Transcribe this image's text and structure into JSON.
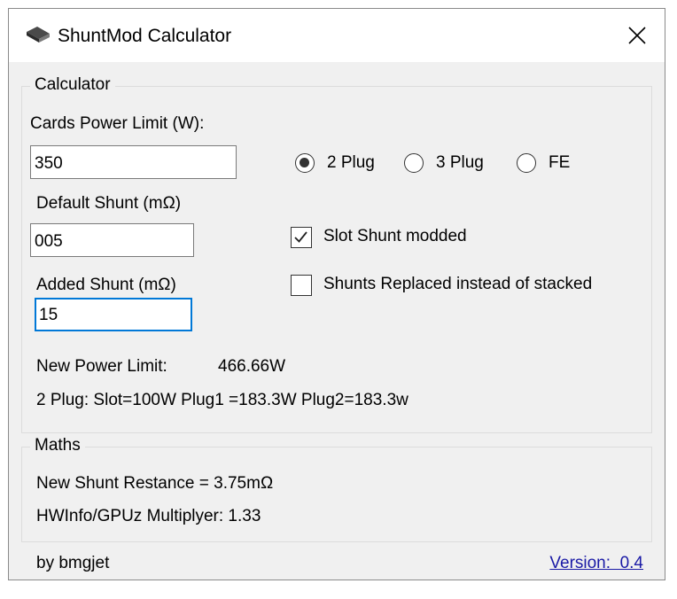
{
  "window": {
    "title": "ShuntMod Calculator"
  },
  "calculator": {
    "group_label": "Calculator",
    "power_limit_label": "Cards Power Limit (W):",
    "power_limit_value": "350",
    "default_shunt_label": "Default Shunt (mΩ)",
    "default_shunt_value": "005",
    "added_shunt_label": "Added Shunt (mΩ)",
    "added_shunt_value": "15",
    "plug_options": [
      {
        "label": "2 Plug",
        "checked": true
      },
      {
        "label": "3 Plug",
        "checked": false
      },
      {
        "label": "FE",
        "checked": false
      }
    ],
    "slot_shunt_label": "Slot Shunt modded",
    "slot_shunt_checked": true,
    "replaced_label": "Shunts Replaced instead of stacked",
    "replaced_checked": false,
    "new_power_label": "New Power Limit:",
    "new_power_value": "466.66W",
    "plug_breakdown": "2 Plug: Slot=100W Plug1 =183.3W Plug2=183.3w"
  },
  "maths": {
    "group_label": "Maths",
    "new_shunt": "New Shunt Restance = 3.75mΩ",
    "multiplier": "HWInfo/GPUz Multiplyer: 1.33"
  },
  "footer": {
    "author": "by bmgjet",
    "version": "Version:  0.4"
  },
  "icons": {
    "app": "hardware-card-icon",
    "close": "close-icon",
    "check": "checkmark-icon"
  }
}
